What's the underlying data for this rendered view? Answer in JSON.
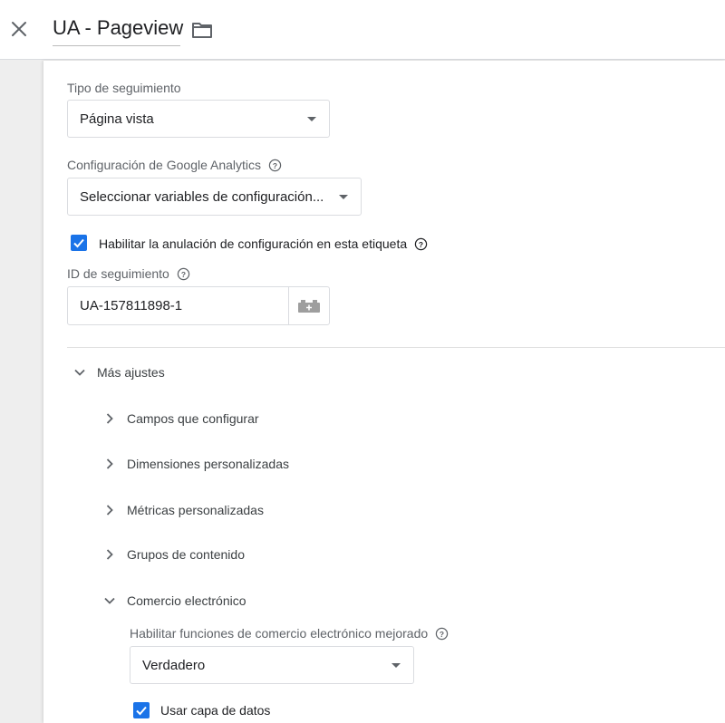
{
  "header": {
    "title": "UA - Pageview",
    "close_icon": "close-icon",
    "folder_icon": "folder-icon"
  },
  "tracking_type": {
    "label": "Tipo de seguimiento",
    "value": "Página vista"
  },
  "ga_settings": {
    "label": "Configuración de Google Analytics",
    "value": "Seleccionar variables de configuración..."
  },
  "override": {
    "label": "Habilitar la anulación de configuración en esta etiqueta",
    "checked": true
  },
  "tracking_id": {
    "label": "ID de seguimiento",
    "value": "UA-157811898-1"
  },
  "more_settings": {
    "label": "Más ajustes",
    "expanded": true,
    "items": [
      {
        "label": "Campos que configurar",
        "expanded": false
      },
      {
        "label": "Dimensiones personalizadas",
        "expanded": false
      },
      {
        "label": "Métricas personalizadas",
        "expanded": false
      },
      {
        "label": "Grupos de contenido",
        "expanded": false
      },
      {
        "label": "Comercio electrónico",
        "expanded": true
      }
    ]
  },
  "ecommerce": {
    "enhanced_label": "Habilitar funciones de comercio electrónico mejorado",
    "enhanced_value": "Verdadero",
    "datalayer_label": "Usar capa de datos",
    "datalayer_checked": true
  },
  "colors": {
    "accent": "#1a73e8",
    "border": "#dadce0",
    "muted_text": "#5f6368"
  }
}
